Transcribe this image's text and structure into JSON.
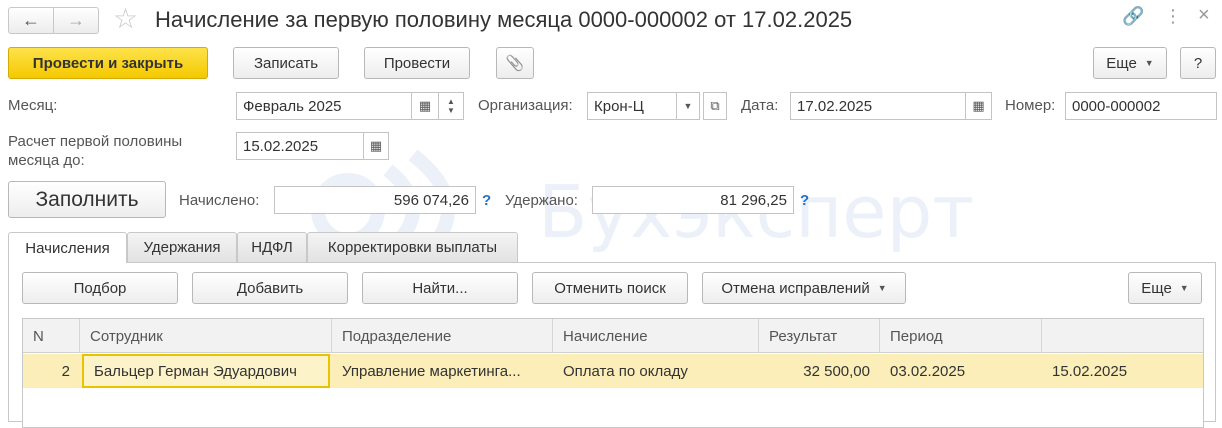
{
  "window": {
    "title": "Начисление за первую половину месяца 0000-000002 от 17.02.2025",
    "back_icon": "←",
    "forward_icon": "→",
    "star_icon": "☆",
    "link_icon": "🔗",
    "more_icon": "⋮",
    "close_icon": "×"
  },
  "toolbar": {
    "post_close_label": "Провести и закрыть",
    "save_label": "Записать",
    "post_label": "Провести",
    "attach_icon": "📎",
    "more_label": "Еще",
    "help_label": "?"
  },
  "form": {
    "month_label": "Месяц:",
    "month_value": "Февраль 2025",
    "org_label": "Организация:",
    "org_value": "Крон-Ц",
    "date_label": "Дата:",
    "date_value": "17.02.2025",
    "number_label": "Номер:",
    "number_value": "0000-000002",
    "calc_label_line1": "Расчет первой половины",
    "calc_label_line2": "месяца до:",
    "calc_value": "15.02.2025",
    "fill_label": "Заполнить",
    "accrued_label": "Начислено:",
    "accrued_value": "596 074,26",
    "withheld_label": "Удержано:",
    "withheld_value": "81 296,25",
    "help_mark": "?"
  },
  "tabs": [
    {
      "label": "Начисления"
    },
    {
      "label": "Удержания"
    },
    {
      "label": "НДФЛ"
    },
    {
      "label": "Корректировки выплаты"
    }
  ],
  "subtoolbar": {
    "pick_label": "Подбор",
    "add_label": "Добавить",
    "find_label": "Найти...",
    "cancel_search_label": "Отменить поиск",
    "cancel_fix_label": "Отмена исправлений",
    "more_label": "Еще"
  },
  "table": {
    "columns": [
      "N",
      "Сотрудник",
      "Подразделение",
      "Начисление",
      "Результат",
      "Период",
      ""
    ],
    "rows": [
      {
        "n": "2",
        "employee": "Бальцер Герман Эдуардович",
        "department": "Управление маркетинга...",
        "accrual": "Оплата по окладу",
        "result": "32 500,00",
        "period_from": "03.02.2025",
        "period_to": "15.02.2025"
      }
    ]
  },
  "watermark": {
    "text": "Бухэксперт"
  },
  "colors": {
    "primary_button": "#f5c900",
    "selected_row": "#fbeeb8",
    "help_mark": "#1e73c8"
  }
}
